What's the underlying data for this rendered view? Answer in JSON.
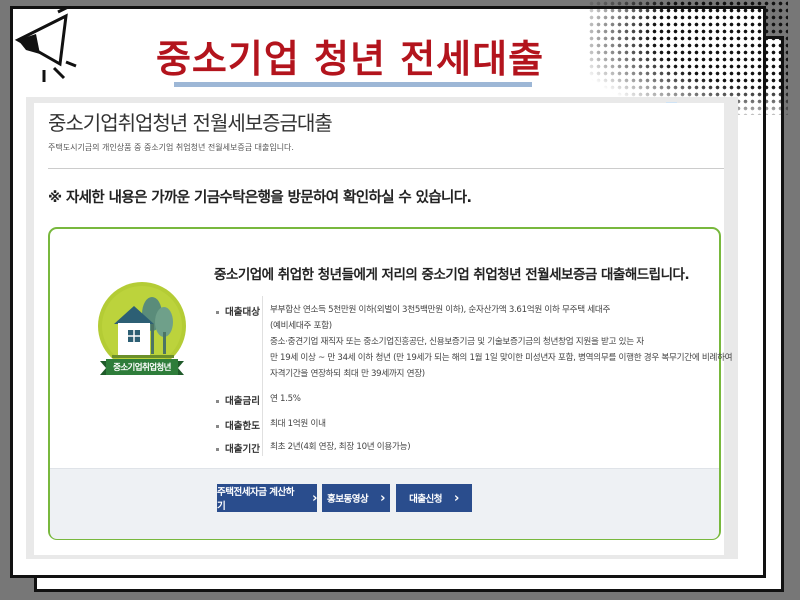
{
  "banner": {
    "title": "중소기업 청년 전세대출"
  },
  "page": {
    "title": "중소기업취업청년 전월세보증금대출",
    "subtitle": "주택도시기금의 개인상품 중 중소기업 취업청년 전월세보증금 대출입니다.",
    "notice": "※ 자세한 내용은 가까운 기금수탁은행을 방문하여 확인하실 수 있습니다."
  },
  "card": {
    "logo_label": "중소기업취업청년",
    "title": "중소기업에 취업한 청년들에게 저리의 중소기업 취업청년 전월세보증금 대출해드립니다.",
    "rows": [
      {
        "label": "대출대상",
        "lines": [
          "부부합산 연소득 5천만원 이하(외벌이 3천5백만원 이하), 순자산가액 3.61억원 이하 무주택 세대주",
          "(예비세대주 포함)",
          "중소·중견기업 재직자 또는 중소기업진흥공단, 신용보증기금 및 기술보증기금의 청년창업 지원을 받고 있는 자",
          "만 19세 이상 ~ 만 34세 이하 청년 (만 19세가 되는 해의 1월 1일 맞이한 미성년자 포함, 병역의무를 이행한 경우 복무기간에 비례하여",
          "자격기간을 연장하되 최대 만 39세까지 연장)"
        ]
      },
      {
        "label": "대출금리",
        "lines": [
          "연 1.5%"
        ]
      },
      {
        "label": "대출한도",
        "lines": [
          "최대 1억원 이내"
        ]
      },
      {
        "label": "대출기간",
        "lines": [
          "최초 2년(4회 연장, 최장 10년 이용가능)"
        ]
      }
    ]
  },
  "buttons": [
    {
      "label": "주택전세자금 계산하기"
    },
    {
      "label": "홍보동영상"
    },
    {
      "label": "대출신청"
    }
  ],
  "colors": {
    "banner_title": "#b3141d",
    "card_border": "#78b83d",
    "button_bg": "#2a4d8d",
    "logo_circle": "#b4cc35",
    "logo_ribbon": "#2e7d3a"
  }
}
